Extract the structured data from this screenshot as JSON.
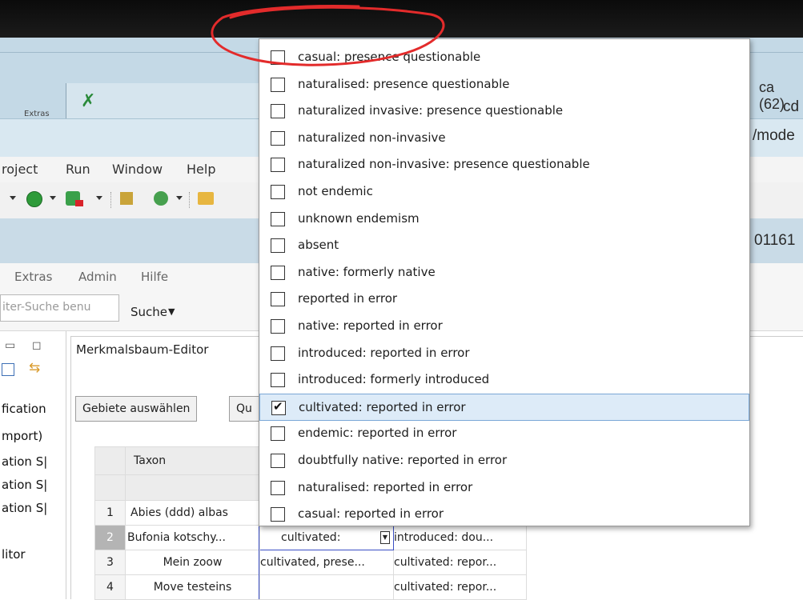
{
  "window": {
    "cut_texts": {
      "left_row1": "...",
      "right_row1": "ca (62)",
      "right_row2": "cd",
      "right_row3": "/mode",
      "status_number": "01161",
      "tab_label": "Extras"
    }
  },
  "ide_menu": [
    "roject",
    "Run",
    "Window",
    "Help"
  ],
  "cms_menu": [
    "Extras",
    "Admin",
    "Hilfe"
  ],
  "search": {
    "placeholder": "iter-Suche benu",
    "button_label": "Suche"
  },
  "left_panel": {
    "items": [
      "fication",
      "mport)",
      "ation S|",
      "ation S|",
      "ation S|",
      "litor"
    ]
  },
  "editor": {
    "tab_title": "Merkmalsbaum-Editor",
    "select_areas_button": "Gebiete auswählen",
    "second_button": "Qu"
  },
  "table": {
    "header_taxon": "Taxon",
    "rows": [
      {
        "num": "1",
        "taxon": "Abies (ddd) albas",
        "c1": "",
        "c2": ""
      },
      {
        "num": "2",
        "taxon": "Bufonia kotschy...",
        "c1": "cultivated:",
        "c2": "introduced: dou..."
      },
      {
        "num": "3",
        "taxon": "Mein zoow",
        "c1": "cultivated, prese...",
        "c2": "cultivated: repor..."
      },
      {
        "num": "4",
        "taxon": "Move testeins",
        "c1": "",
        "c2": "cultivated: repor..."
      }
    ]
  },
  "dropdown": {
    "options": [
      {
        "label": "casual: presence questionable",
        "checked": false
      },
      {
        "label": "naturalised: presence questionable",
        "checked": false
      },
      {
        "label": "naturalized  invasive: presence questionable",
        "checked": false
      },
      {
        "label": "naturalized  non-invasive",
        "checked": false
      },
      {
        "label": "naturalized  non-invasive: presence questionable",
        "checked": false
      },
      {
        "label": "not endemic",
        "checked": false
      },
      {
        "label": "unknown endemism",
        "checked": false
      },
      {
        "label": "absent",
        "checked": false
      },
      {
        "label": "native: formerly native",
        "checked": false
      },
      {
        "label": "reported in error",
        "checked": false
      },
      {
        "label": "native: reported in error",
        "checked": false
      },
      {
        "label": "introduced: reported in error",
        "checked": false
      },
      {
        "label": "introduced: formerly introduced",
        "checked": false
      },
      {
        "label": "cultivated: reported in error",
        "checked": true
      },
      {
        "label": "endemic: reported in error",
        "checked": false
      },
      {
        "label": "doubtfully native: reported in error",
        "checked": false
      },
      {
        "label": "naturalised: reported in error",
        "checked": false
      },
      {
        "label": "casual: reported in error",
        "checked": false
      }
    ]
  },
  "colors": {
    "annotation": "#e32b2b",
    "selection": "#ddebf8",
    "title_blue": "#c4d9e6"
  }
}
